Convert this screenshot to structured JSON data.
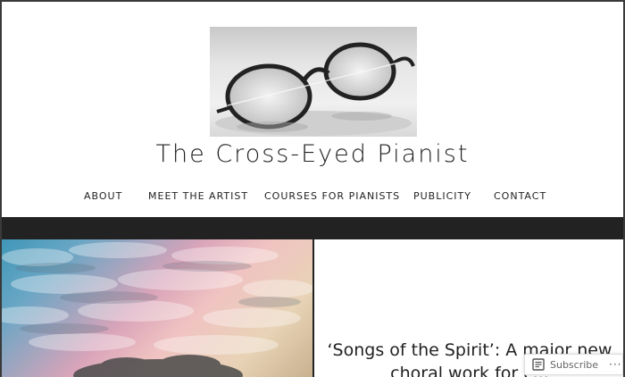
{
  "site": {
    "title": "The Cross-Eyed Pianist"
  },
  "nav": {
    "items": [
      {
        "label": "ABOUT"
      },
      {
        "label": "MEET THE ARTIST"
      },
      {
        "label": "COURSES FOR PIANISTS"
      },
      {
        "label": "PUBLICITY"
      },
      {
        "label": "CONTACT"
      }
    ]
  },
  "post": {
    "title": "‘Songs of the Spirit’: A major new choral work for c..."
  },
  "subscribe": {
    "label": "Subscribe",
    "more": "···"
  },
  "icons": {
    "subscribe": "reader-icon",
    "logo": "eyeglasses-photo"
  }
}
